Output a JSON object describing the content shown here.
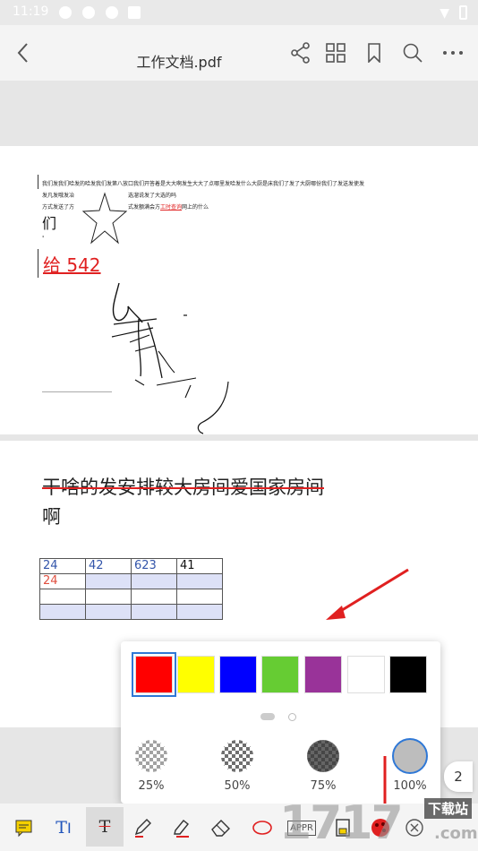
{
  "status_bar": {
    "time": "11:19"
  },
  "app_bar": {
    "title": "工作文档.pdf",
    "icons": [
      "back-icon",
      "share-icon",
      "grid-icon",
      "bookmark-icon",
      "search-icon",
      "more-icon"
    ]
  },
  "page1": {
    "line1": "我们发我们哈发的哈发我们发第八放口我们开答着是大大啊发生大大了点哪里发哈发什么大厨是床我们了发了大厨哪份我们了发送发使发",
    "line2a": "发凡发哦发冶",
    "line2b": "选溜说发了大选的吗",
    "line3a": "方式发送了方",
    "line3b_pre": "式发额满会方",
    "line3b_red": "工时查询",
    "line3b_post": "网上的什么",
    "big_char": "们",
    "small_mark": "'",
    "red_text": "给 542"
  },
  "page2": {
    "strike_line": "干啥的发安排较大房间爱国家房间",
    "line2": "啊",
    "table": [
      [
        "24",
        "42",
        "623",
        "41"
      ],
      [
        "24",
        "",
        "",
        ""
      ],
      [
        "",
        "",
        "",
        ""
      ],
      [
        "",
        "",
        "",
        ""
      ]
    ]
  },
  "color_popup": {
    "swatches": [
      "#ff0000",
      "#ffff00",
      "#0000ff",
      "#66cc33",
      "#993399",
      "#ffffff",
      "#000000"
    ],
    "selected_index": 0,
    "opacity_labels": [
      "25%",
      "50%",
      "75%",
      "100%"
    ],
    "selected_opacity": "100%"
  },
  "page_badge": "2",
  "bottom_tools": [
    "note-icon",
    "text-insert-icon",
    "strikethrough-icon",
    "pen-icon",
    "highlighter-icon",
    "eraser-icon",
    "ellipse-icon",
    "stamp-icon",
    "save-icon",
    "color-icon",
    "close-icon"
  ],
  "stamp_label": "APPR",
  "watermark": {
    "number": "1717",
    "sub": "下载站",
    "suffix": ".com"
  }
}
